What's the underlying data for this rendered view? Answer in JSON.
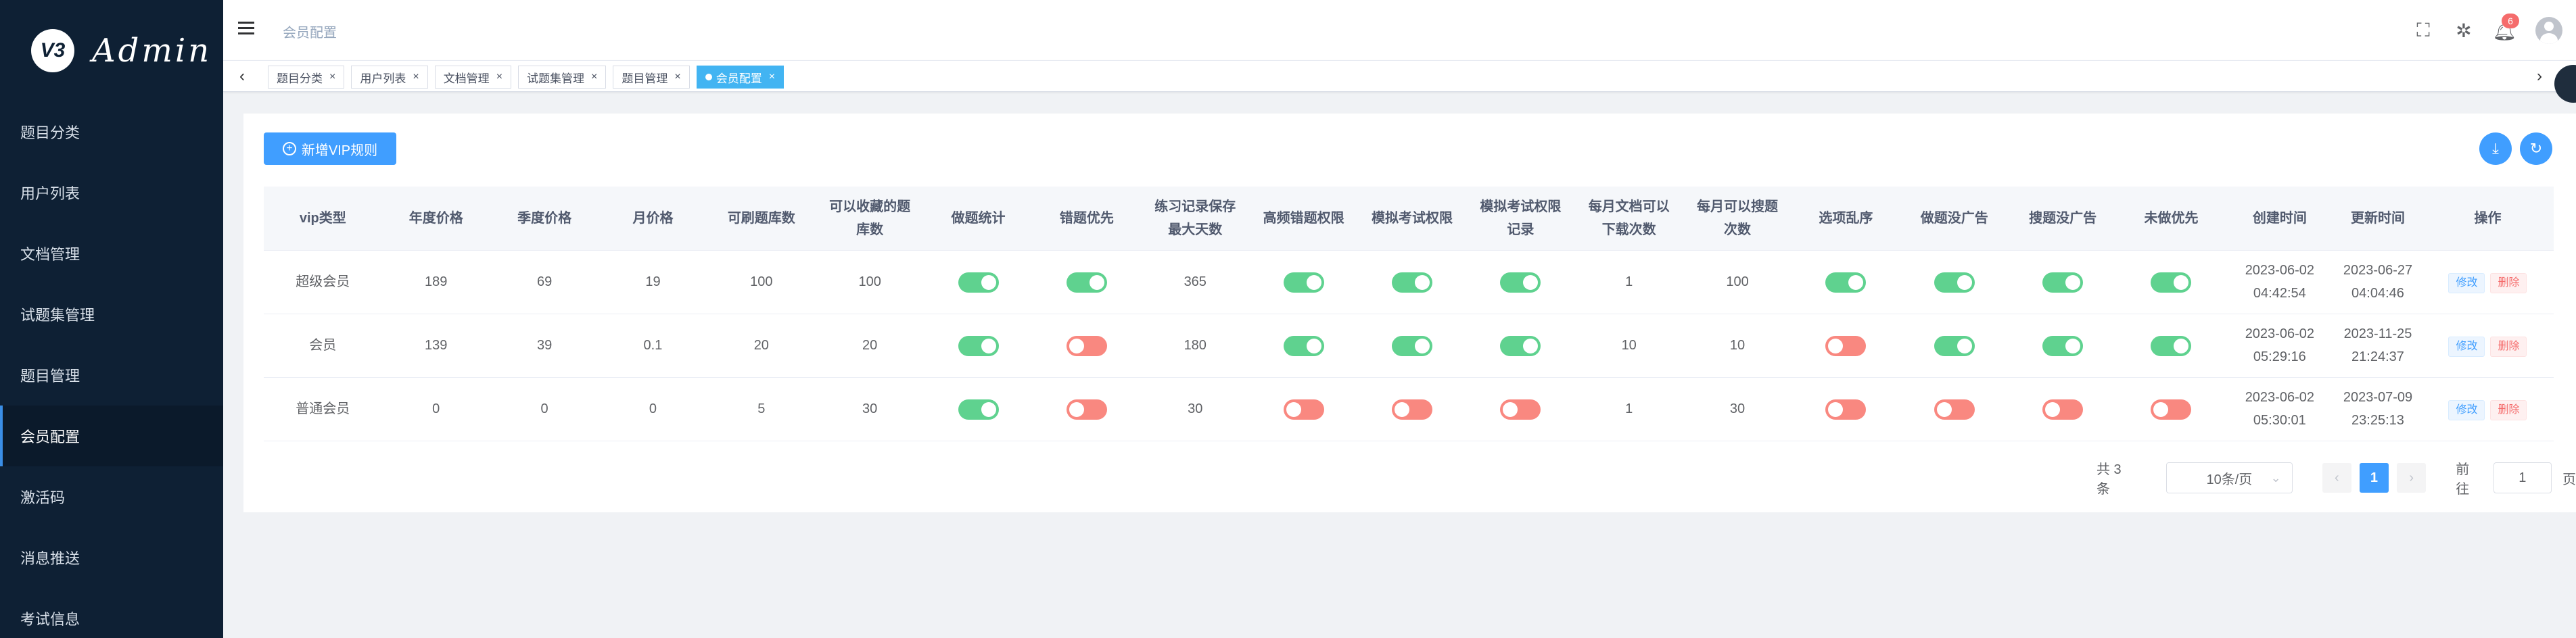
{
  "brand": {
    "logo_mark": "V3",
    "logo_text": "Admin"
  },
  "sidebar": {
    "items": [
      {
        "label": "题目分类"
      },
      {
        "label": "用户列表"
      },
      {
        "label": "文档管理"
      },
      {
        "label": "试题集管理"
      },
      {
        "label": "题目管理"
      },
      {
        "label": "会员配置",
        "active": true
      },
      {
        "label": "激活码"
      },
      {
        "label": "消息推送"
      },
      {
        "label": "考试信息"
      }
    ]
  },
  "header": {
    "breadcrumb": "会员配置",
    "notification_count": "6",
    "icons": [
      "fullscreen-icon",
      "sparkle-icon",
      "bell-icon",
      "avatar"
    ]
  },
  "tags": [
    {
      "label": "题目分类"
    },
    {
      "label": "用户列表"
    },
    {
      "label": "文档管理"
    },
    {
      "label": "试题集管理"
    },
    {
      "label": "题目管理"
    },
    {
      "label": "会员配置",
      "active": true
    }
  ],
  "toolbar": {
    "add_label": "新增VIP规则"
  },
  "table": {
    "columns": [
      "vip类型",
      "年度价格",
      "季度价格",
      "月价格",
      "可刷题库数",
      "可以收藏的题库数",
      "做题统计",
      "错题优先",
      "练习记录保存最大天数",
      "高频错题权限",
      "模拟考试权限",
      "模拟考试权限记录",
      "每月文档可以下载次数",
      "每月可以搜题次数",
      "选项乱序",
      "做题没广告",
      "搜题没广告",
      "未做优先",
      "创建时间",
      "更新时间",
      "操作"
    ],
    "rows": [
      {
        "vip_type": "超级会员",
        "annual": "189",
        "quarterly": "69",
        "monthly": "19",
        "bank_count": "100",
        "favorites": "100",
        "stats": true,
        "wrong_first": true,
        "days": "365",
        "freq_wrong": true,
        "mock": true,
        "mock_record": true,
        "doc_downloads": "1",
        "searches": "100",
        "shuffle": true,
        "no_ad_practice": true,
        "no_ad_search": true,
        "undone_first": true,
        "created_date": "2023-06-02",
        "created_time": "04:42:54",
        "updated_date": "2023-06-27",
        "updated_time": "04:04:46"
      },
      {
        "vip_type": "会员",
        "annual": "139",
        "quarterly": "39",
        "monthly": "0.1",
        "bank_count": "20",
        "favorites": "20",
        "stats": true,
        "wrong_first": false,
        "days": "180",
        "freq_wrong": true,
        "mock": true,
        "mock_record": true,
        "doc_downloads": "10",
        "searches": "10",
        "shuffle": false,
        "no_ad_practice": true,
        "no_ad_search": true,
        "undone_first": true,
        "created_date": "2023-06-02",
        "created_time": "05:29:16",
        "updated_date": "2023-11-25",
        "updated_time": "21:24:37"
      },
      {
        "vip_type": "普通会员",
        "annual": "0",
        "quarterly": "0",
        "monthly": "0",
        "bank_count": "5",
        "favorites": "30",
        "stats": true,
        "wrong_first": false,
        "days": "30",
        "freq_wrong": false,
        "mock": false,
        "mock_record": false,
        "doc_downloads": "1",
        "searches": "30",
        "shuffle": false,
        "no_ad_practice": false,
        "no_ad_search": false,
        "undone_first": false,
        "created_date": "2023-06-02",
        "created_time": "05:30:01",
        "updated_date": "2023-07-09",
        "updated_time": "23:25:13"
      }
    ],
    "actions": {
      "edit": "修改",
      "delete": "删除"
    }
  },
  "pagination": {
    "total_text": "共 3 条",
    "page_size": "10条/页",
    "current_page": "1",
    "goto_label": "前往",
    "goto_value": "1",
    "page_suffix": "页"
  },
  "colors": {
    "sidebar_bg": "#0e2034",
    "primary": "#409eff",
    "switch_on": "#5fd28f",
    "switch_off": "#f98880",
    "active_tag": "#42b4f2"
  }
}
